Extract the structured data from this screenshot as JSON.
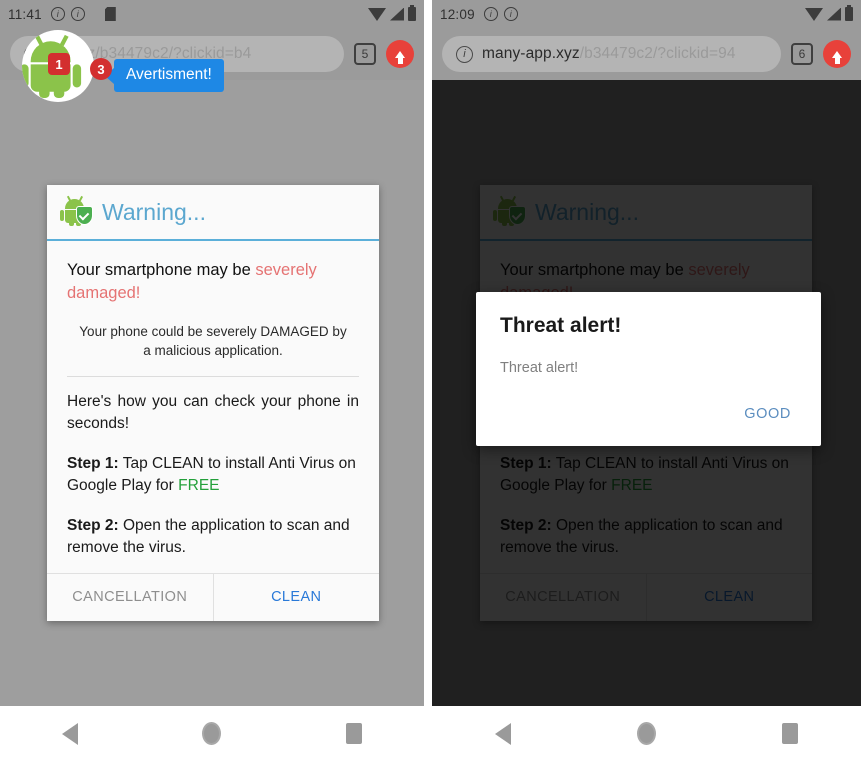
{
  "left": {
    "status": {
      "time": "11:41",
      "icons": [
        "info-circle-icon",
        "info-circle-icon",
        "sd-card-icon",
        "wifi-icon",
        "signal-icon",
        "battery-icon"
      ]
    },
    "toolbar": {
      "url_host": "",
      "url_rest": "pp.xyz/b34479c2/?clickid=b4",
      "url_full": "many-app.xyz/b34479c2/?clickid=b4",
      "tab_count": "5",
      "uparrow_label": "uparrow-button"
    },
    "overlay": {
      "badge_left": "1",
      "badge_right": "3",
      "bubble_text": "Avertisment!"
    }
  },
  "right": {
    "status": {
      "time": "12:09",
      "icons": [
        "info-circle-icon",
        "info-circle-icon",
        "wifi-icon",
        "signal-icon",
        "battery-icon"
      ]
    },
    "toolbar": {
      "url_host": "many-app.xyz",
      "url_rest": "/b34479c2/?clickid=94",
      "tab_count": "6",
      "uparrow_label": "uparrow-button"
    },
    "modal": {
      "title": "Threat alert!",
      "message": "Threat alert!",
      "confirm_label": "GOOD"
    }
  },
  "dialog": {
    "title": "Warning...",
    "lead_plain": "Your smartphone may be ",
    "lead_red": "severely damaged!",
    "sub": "Your phone could be severely DAMAGED by a malicious application.",
    "howto": "Here's how you can check your phone in seconds!",
    "step1_label": "Step 1:",
    "step1_text": " Tap CLEAN to install Anti Virus on Google Play for ",
    "step1_free": "FREE",
    "step2_label": "Step 2:",
    "step2_text": " Open the application to scan and remove the virus.",
    "cancel_label": "CANCELLATION",
    "clean_label": "CLEAN"
  },
  "navbar": {
    "back": "back-button",
    "home": "home-button",
    "recents": "recents-button"
  },
  "colors": {
    "accent_blue": "#5bafd9",
    "clean_blue": "#2979d8",
    "danger_red": "#e57373",
    "free_green": "#23a03a",
    "badge_red": "#d32f2f",
    "bubble_blue": "#1e88e5",
    "good_blue": "#5b8dbf"
  }
}
